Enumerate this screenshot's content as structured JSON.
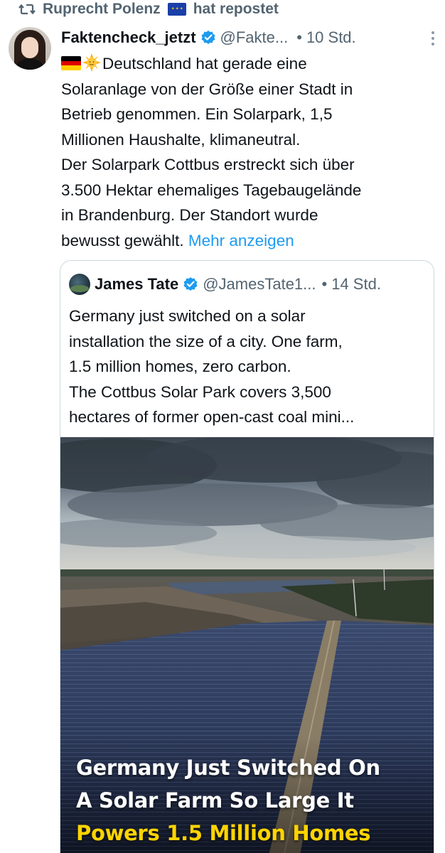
{
  "repost": {
    "label_name": "Ruprecht Polenz",
    "label_suffix": "hat repostet",
    "icon": "repost-icon",
    "flag": "eu-flag-icon"
  },
  "tweet": {
    "author_name": "Faktencheck_jetzt",
    "handle": "@Fakte...",
    "separator": "•",
    "time": "10 Std.",
    "more_icon": "more-dots-icon",
    "lines": [
      "Deutschland hat gerade eine",
      "Solaranlage von der Größe einer Stadt in",
      "Betrieb genommen. Ein Solarpark, 1,5",
      "Millionen Haushalte, klimaneutral.",
      "Der Solarpark Cottbus erstreckt sich über",
      "3.500 Hektar ehemaliges Tagebaugelände",
      "in Brandenburg. Der Standort wurde",
      "bewusst gewählt."
    ],
    "show_more": "Mehr anzeigen",
    "emojis": [
      "germany-flag-icon",
      "sun-icon"
    ]
  },
  "quote": {
    "author_name": "James Tate",
    "handle": "@JamesTate1...",
    "separator": "•",
    "time": "14 Std.",
    "lines": [
      "Germany just switched on a solar",
      "installation the size of a city. One farm,",
      "1.5 million homes, zero carbon.",
      "The Cottbus Solar Park covers 3,500",
      "hectares of former open-cast coal mini..."
    ],
    "image_caption": [
      "Germany Just Switched On",
      "A Solar Farm So Large It",
      "Powers 1.5 Million Homes"
    ]
  },
  "colors": {
    "link": "#1d9bf0",
    "secondary_text": "#536471",
    "verified": "#1d9bf0",
    "caption_highlight": "#ffd400"
  }
}
